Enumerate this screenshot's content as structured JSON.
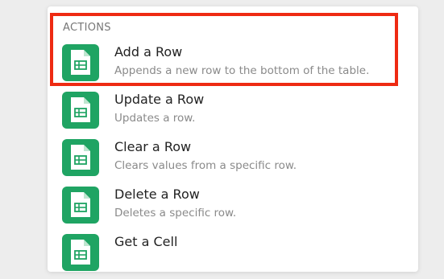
{
  "section": {
    "title": "ACTIONS"
  },
  "actions": [
    {
      "title": "Add a Row",
      "description": "Appends a new row to the bottom of the table.",
      "icon": "google-sheets-icon"
    },
    {
      "title": "Update a Row",
      "description": "Updates a row.",
      "icon": "google-sheets-icon"
    },
    {
      "title": "Clear a Row",
      "description": "Clears values from a specific row.",
      "icon": "google-sheets-icon"
    },
    {
      "title": "Delete a Row",
      "description": "Deletes a specific row.",
      "icon": "google-sheets-icon"
    },
    {
      "title": "Get a Cell",
      "description": "",
      "icon": "google-sheets-icon"
    }
  ],
  "colors": {
    "icon_bg": "#1fa463",
    "highlight": "#ee2a12"
  }
}
